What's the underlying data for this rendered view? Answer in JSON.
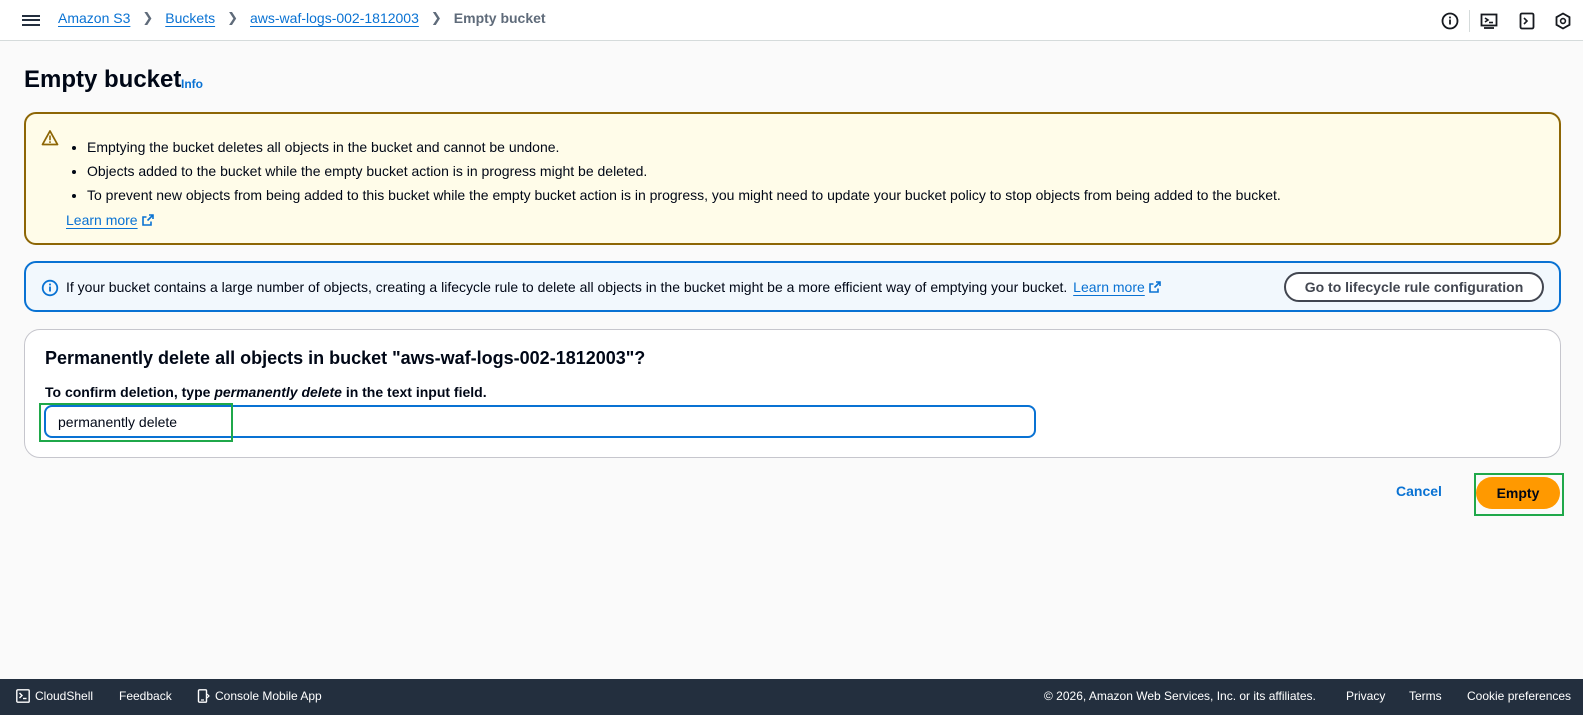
{
  "topbar": {
    "breadcrumbs": [
      "Amazon S3",
      "Buckets",
      "aws-waf-logs-002-1812003"
    ],
    "current": "Empty bucket",
    "icons": [
      "info-circle-icon",
      "cloudshell-icon",
      "notifications-icon",
      "settings-icon"
    ]
  },
  "page": {
    "title": "Empty bucket",
    "info_link": "Info"
  },
  "warning": {
    "items": [
      "Emptying the bucket deletes all objects in the bucket and cannot be undone.",
      "Objects added to the bucket while the empty bucket action is in progress might be deleted.",
      "To prevent new objects from being added to this bucket while the empty bucket action is in progress, you might need to update your bucket policy to stop objects from being added to the bucket."
    ],
    "learn_more": "Learn more"
  },
  "info_alert": {
    "text": "If your bucket contains a large number of objects, creating a lifecycle rule to delete all objects in the bucket might be a more efficient way of emptying your bucket.",
    "learn_more": "Learn more",
    "button": "Go to lifecycle rule configuration"
  },
  "confirm": {
    "heading": "Permanently delete all objects in bucket \"aws-waf-logs-002-1812003\"?",
    "label_prefix": "To confirm deletion, type",
    "label_em": "permanently delete",
    "label_suffix": "in the text input field.",
    "input_value": "permanently delete"
  },
  "actions": {
    "cancel": "Cancel",
    "empty": "Empty"
  },
  "footer": {
    "cloudshell": "CloudShell",
    "feedback": "Feedback",
    "mobile_app": "Console Mobile App",
    "copyright": "© 2026, Amazon Web Services, Inc. or its affiliates.",
    "privacy": "Privacy",
    "terms": "Terms",
    "cookie": "Cookie preferences"
  },
  "colors": {
    "link": "#0972d3",
    "warning_border": "#8d6605",
    "warning_bg": "#fffce9",
    "info_border": "#0972d3",
    "info_bg": "#f2f8fd",
    "primary_button": "#ff9900",
    "highlight": "#1fa84a",
    "footer_bg": "#232f3e"
  }
}
